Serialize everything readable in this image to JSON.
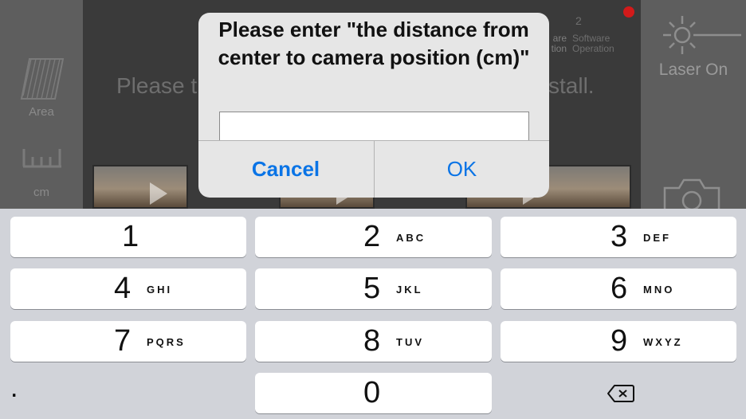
{
  "background": {
    "sidebar": {
      "area_label": "Area",
      "unit_label": "cm"
    },
    "right_panel": {
      "laser_label": "Laser On"
    },
    "instruction": {
      "visible_start": "Please t",
      "visible_end": "stall."
    },
    "steps": {
      "step1_text": "are\ntion",
      "step2_number": "2",
      "step2_text": "Software\nOperation"
    }
  },
  "alert": {
    "title": "Please enter \"the distance from center to camera position (cm)\"",
    "input_value": "",
    "input_placeholder": "",
    "cancel_label": "Cancel",
    "ok_label": "OK"
  },
  "keypad": {
    "keys": [
      {
        "digit": "1",
        "letters": ""
      },
      {
        "digit": "2",
        "letters": "ABC"
      },
      {
        "digit": "3",
        "letters": "DEF"
      },
      {
        "digit": "4",
        "letters": "GHI"
      },
      {
        "digit": "5",
        "letters": "JKL"
      },
      {
        "digit": "6",
        "letters": "MNO"
      },
      {
        "digit": "7",
        "letters": "PQRS"
      },
      {
        "digit": "8",
        "letters": "TUV"
      },
      {
        "digit": "9",
        "letters": "WXYZ"
      },
      {
        "digit": "0",
        "letters": ""
      }
    ],
    "dot_label": ".",
    "backspace_icon": "backspace-icon"
  },
  "colors": {
    "accent": "#0a74e6",
    "notification": "#d21a1a"
  }
}
